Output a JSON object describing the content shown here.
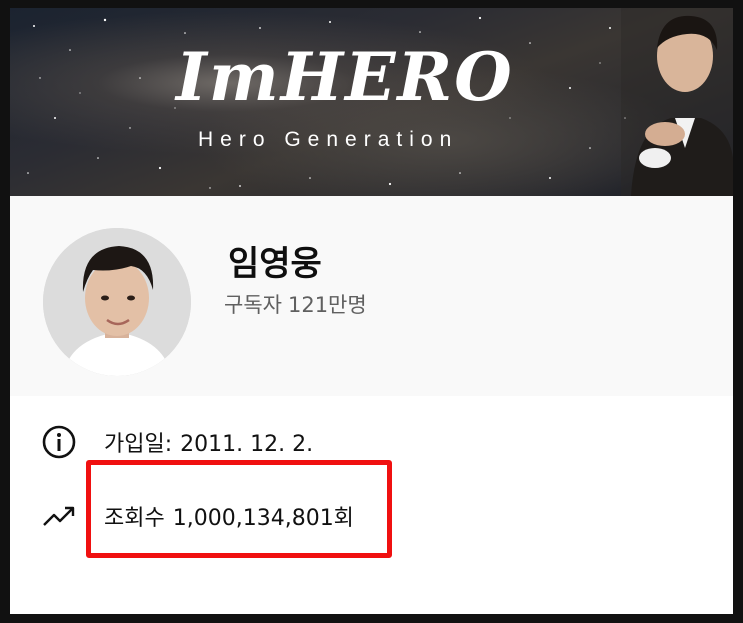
{
  "banner": {
    "logo_text": "ImHERO",
    "logo_subtitle": "Hero Generation"
  },
  "channel": {
    "name": "임영웅",
    "subscribers_label": "구독자",
    "subscribers_count": "121만명"
  },
  "about": {
    "joined_label": "가입일:",
    "joined_date": "2011. 12. 2.",
    "views_label": "조회수",
    "views_count": "1,000,134,801회"
  },
  "colors": {
    "highlight": "#f01010",
    "secondary_text": "#606060"
  },
  "icons": {
    "joined": "info-icon",
    "views": "trending-up-icon"
  }
}
